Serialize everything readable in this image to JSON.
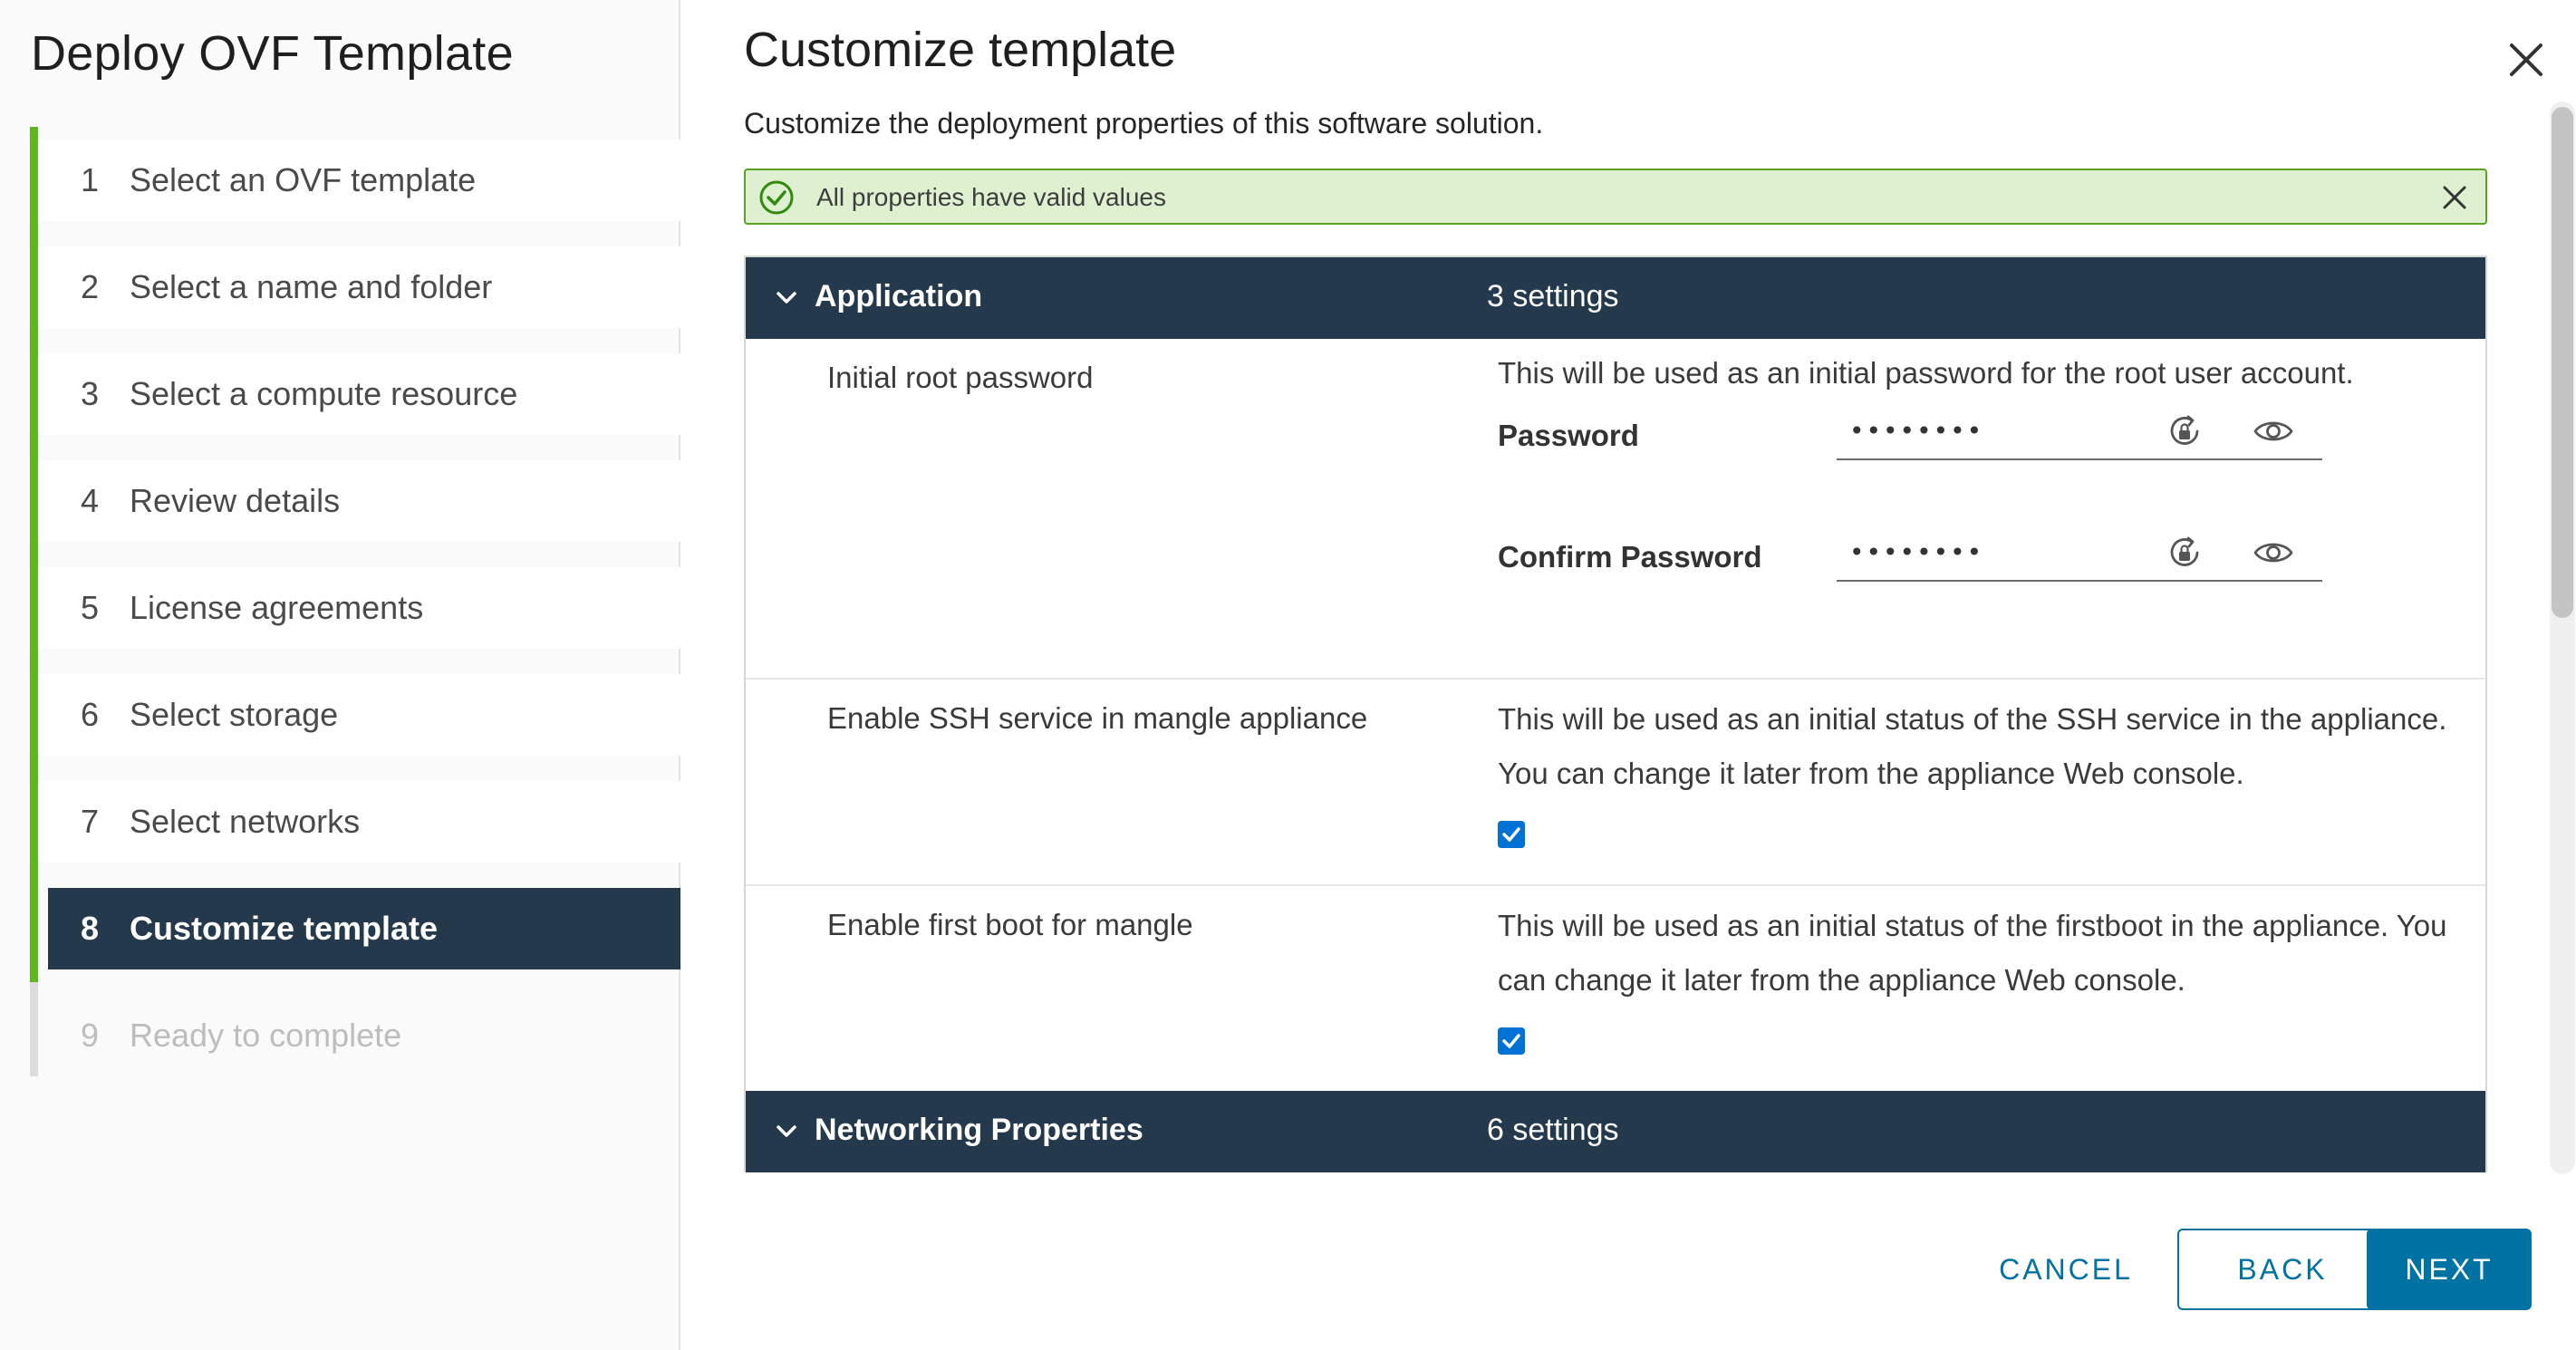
{
  "wizard": {
    "title": "Deploy OVF Template",
    "steps": [
      {
        "num": "1",
        "label": "Select an OVF template",
        "state": "done"
      },
      {
        "num": "2",
        "label": "Select a name and folder",
        "state": "done"
      },
      {
        "num": "3",
        "label": "Select a compute resource",
        "state": "done"
      },
      {
        "num": "4",
        "label": "Review details",
        "state": "done"
      },
      {
        "num": "5",
        "label": "License agreements",
        "state": "done"
      },
      {
        "num": "6",
        "label": "Select storage",
        "state": "done"
      },
      {
        "num": "7",
        "label": "Select networks",
        "state": "done"
      },
      {
        "num": "8",
        "label": "Customize template",
        "state": "active"
      },
      {
        "num": "9",
        "label": "Ready to complete",
        "state": "future"
      }
    ]
  },
  "page": {
    "title": "Customize template",
    "subtitle": "Customize the deployment properties of this software solution."
  },
  "alert": {
    "message": "All properties have valid values",
    "status": "success",
    "icon": "check-circle-icon"
  },
  "sections": {
    "application": {
      "name": "Application",
      "count": "3 settings",
      "rows": {
        "root_password": {
          "label": "Initial root password",
          "description": "This will be used as an initial password for the root user account.",
          "password_label": "Password",
          "password_value": "••••••••",
          "confirm_label": "Confirm Password",
          "confirm_value": "••••••••"
        },
        "ssh": {
          "label": "Enable SSH service in mangle appliance",
          "description": "This will be used as an initial status of the SSH service in the appliance. You can change it later from the appliance Web console.",
          "checked": true
        },
        "firstboot": {
          "label": "Enable first boot for mangle",
          "description": "This will be used as an initial status of the firstboot in the appliance. You can change it later from the appliance Web console.",
          "checked": true
        }
      }
    },
    "networking": {
      "name": "Networking Properties",
      "count": "6 settings"
    }
  },
  "footer": {
    "cancel": "CANCEL",
    "back": "BACK",
    "next": "NEXT"
  },
  "colors": {
    "accent": "#0072a3",
    "nav_dark": "#243a4c",
    "progress_green": "#5fb61f",
    "alert_bg": "#dff0d0",
    "alert_border": "#5aa220",
    "checkbox": "#0072d6"
  }
}
